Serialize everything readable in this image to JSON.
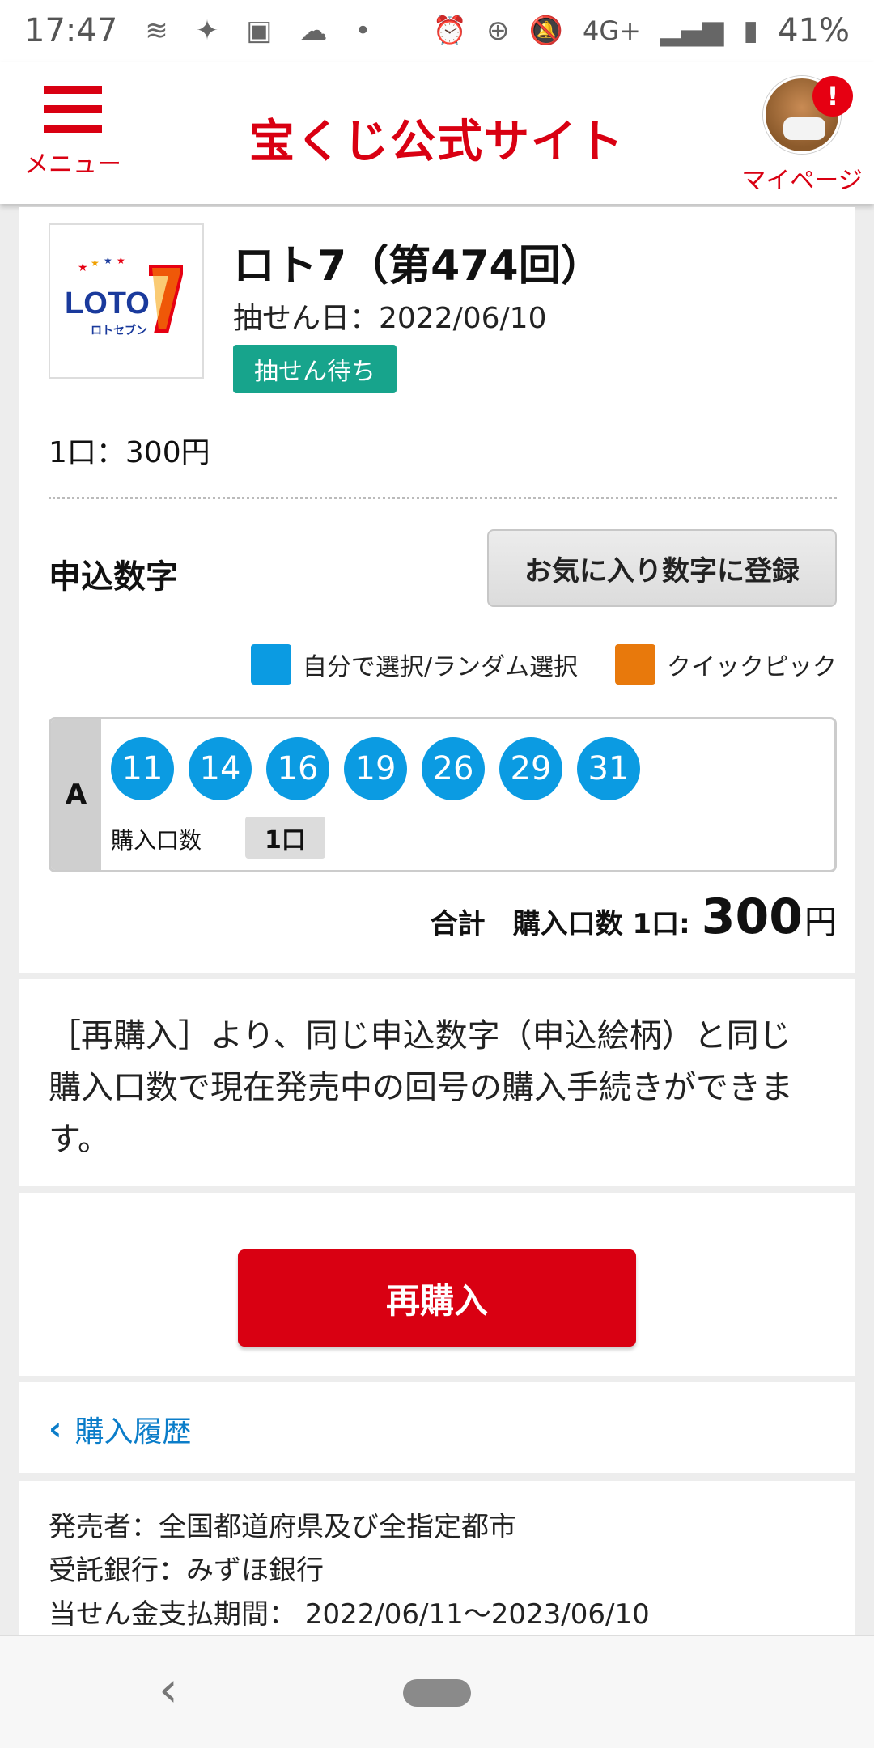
{
  "status_bar": {
    "time": "17:47",
    "battery": "41%",
    "network": "4G+"
  },
  "header": {
    "menu_label": "メニュー",
    "site_title": "宝くじ公式サイト",
    "mypage_label": "マイページ",
    "notification_badge": "!"
  },
  "lottery": {
    "logo_text": "LOTO",
    "logo_number": "7",
    "logo_sub": "ロトセブン",
    "title": "ロト7（第474回）",
    "draw_date": "抽せん日：2022/06/10",
    "status": "抽せん待ち",
    "unit_price": "1口：300円"
  },
  "selection": {
    "label": "申込数字",
    "favorite_button": "お気に入り数字に登録",
    "legend_manual": "自分で選択/ランダム選択",
    "legend_quick": "クイックピック",
    "colors": {
      "manual": "#0b9be2",
      "quick": "#e8790c"
    }
  },
  "numbers": {
    "row_label": "A",
    "balls": [
      "11",
      "14",
      "16",
      "19",
      "26",
      "29",
      "31"
    ],
    "qty_label": "購入口数",
    "qty_value": "1口"
  },
  "total": {
    "label": "合計　購入口数 1口:",
    "amount": "300",
    "currency": "円"
  },
  "info": {
    "text": "［再購入］より、同じ申込数字（申込絵柄）と同じ購入口数で現在発売中の回号の購入手続きができます。"
  },
  "rebuy": {
    "button": "再購入"
  },
  "history": {
    "link": "購入履歴"
  },
  "footer": {
    "seller": "発売者：全国都道府県及び全指定都市",
    "bank": "受託銀行：みずほ銀行",
    "payout_period": "当せん金支払期間：  2022/06/11〜2023/06/10"
  }
}
